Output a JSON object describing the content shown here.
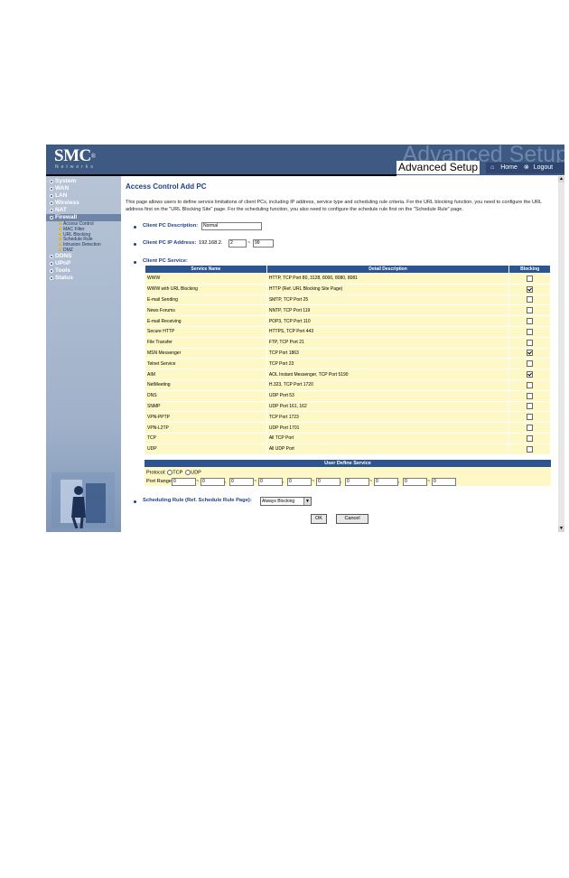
{
  "header": {
    "logo": "SMC",
    "logo_mark": "®",
    "logo_sub": "Networks",
    "ghost_text": "Advanced Setup",
    "label": "Advanced Setup",
    "home": "Home",
    "logout": "Logout"
  },
  "sidebar": {
    "items": [
      {
        "label": "System"
      },
      {
        "label": "WAN"
      },
      {
        "label": "LAN"
      },
      {
        "label": "Wireless"
      },
      {
        "label": "NAT"
      },
      {
        "label": "Firewall"
      },
      {
        "label": "DDNS"
      },
      {
        "label": "UPnP"
      },
      {
        "label": "Tools"
      },
      {
        "label": "Status"
      }
    ],
    "firewall_sub": [
      "Access Control",
      "MAC Filter",
      "URL Blocking",
      "Schedule Rule",
      "Intrusion Detection",
      "DMZ"
    ]
  },
  "page": {
    "title": "Access Control Add PC",
    "description": "This page allows users to define service limitations of client PCs, including IP address, service type and scheduling rule criteria. For the URL blocking function, you need to configure the URL address first on the \"URL Blocking Site\" page. For the scheduling function, you also need to configure the schedule rule first on the \"Schedule Rule\" page.",
    "pc_description_label": "Client PC Description:",
    "pc_description_value": "Normal",
    "ip_label": "Client PC IP Address:",
    "ip_prefix": "192.168.2.",
    "ip_start": "2",
    "ip_sep": "~",
    "ip_end": "99",
    "service_label": "Client PC Service:"
  },
  "table": {
    "headers": [
      "Service Name",
      "Detail Description",
      "Blocking"
    ],
    "rows": [
      {
        "name": "WWW",
        "detail": "HTTP, TCP Port 80, 3128, 8000, 8080, 8081",
        "blocked": false
      },
      {
        "name": "WWW with URL Blocking",
        "detail": "HTTP (Ref. URL Blocking Site Page)",
        "blocked": true
      },
      {
        "name": "E-mail Sending",
        "detail": "SMTP, TCP Port 25",
        "blocked": false
      },
      {
        "name": "News Forums",
        "detail": "NNTP, TCP Port 119",
        "blocked": false
      },
      {
        "name": "E-mail Receiving",
        "detail": "POP3, TCP Port 110",
        "blocked": false
      },
      {
        "name": "Secure HTTP",
        "detail": "HTTPS, TCP Port 443",
        "blocked": false
      },
      {
        "name": "File Transfer",
        "detail": "FTP, TCP Port 21",
        "blocked": false
      },
      {
        "name": "MSN Messenger",
        "detail": "TCP Port 1863",
        "blocked": true
      },
      {
        "name": "Telnet Service",
        "detail": "TCP Port 23",
        "blocked": false
      },
      {
        "name": "AIM",
        "detail": "AOL Instant Messenger, TCP Port 5190",
        "blocked": true
      },
      {
        "name": "NetMeeting",
        "detail": "H.323, TCP Port 1720",
        "blocked": false
      },
      {
        "name": "DNS",
        "detail": "UDP Port 53",
        "blocked": false
      },
      {
        "name": "SNMP",
        "detail": "UDP Port 161, 162",
        "blocked": false
      },
      {
        "name": "VPN-PPTP",
        "detail": "TCP Port 1723",
        "blocked": false
      },
      {
        "name": "VPN-L2TP",
        "detail": "UDP Port 1701",
        "blocked": false
      },
      {
        "name": "TCP",
        "detail": "All TCP Port",
        "blocked": false
      },
      {
        "name": "UDP",
        "detail": "All UDP Port",
        "blocked": false
      }
    ]
  },
  "user_define": {
    "title": "User Define Service",
    "protocol_label": "Protocol:",
    "tcp": "TCP",
    "udp": "UDP",
    "port_range_label": "Port Range:",
    "port_values": [
      "0",
      "0",
      "0",
      "0",
      "0",
      "0",
      "0",
      "0",
      "0",
      "0"
    ],
    "range_sep": "~",
    "pair_sep": ","
  },
  "schedule": {
    "label": "Scheduling Rule (Ref. Schedule Rule Page):",
    "value": "Always Blocking"
  },
  "buttons": {
    "ok": "OK",
    "cancel": "Cancel"
  }
}
